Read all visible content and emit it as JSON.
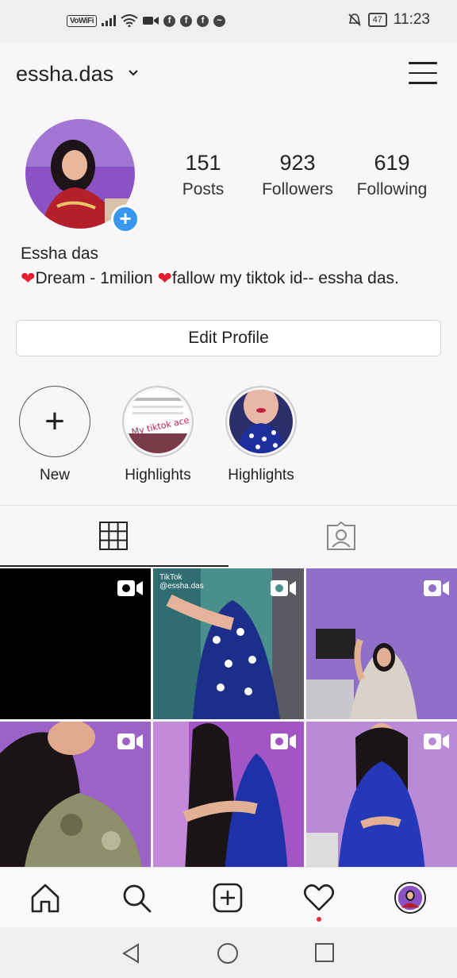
{
  "status_bar": {
    "network_badge": "VoWiFi",
    "battery": "47",
    "time": "11:23"
  },
  "header": {
    "username": "essha.das"
  },
  "profile": {
    "stats": [
      {
        "count": "151",
        "label": "Posts"
      },
      {
        "count": "923",
        "label": "Followers"
      },
      {
        "count": "619",
        "label": "Following"
      }
    ],
    "full_name": "Essha das",
    "bio": "Dream - 1milion ",
    "bio_rest": "fallow my tiktok id-- essha das.",
    "edit_button": "Edit Profile"
  },
  "highlights": [
    {
      "label": "New"
    },
    {
      "label": "Highlights",
      "sticker_text": "My tiktok aceunt"
    },
    {
      "label": "Highlights"
    }
  ],
  "tabs": [
    "grid-icon",
    "tagged-icon"
  ],
  "grid": {
    "tiktok_watermark": "TikTok",
    "tiktok_handle": "@essha.das"
  },
  "colors": {
    "accent_blue": "#3897f0",
    "notification_red": "#e0303a"
  }
}
